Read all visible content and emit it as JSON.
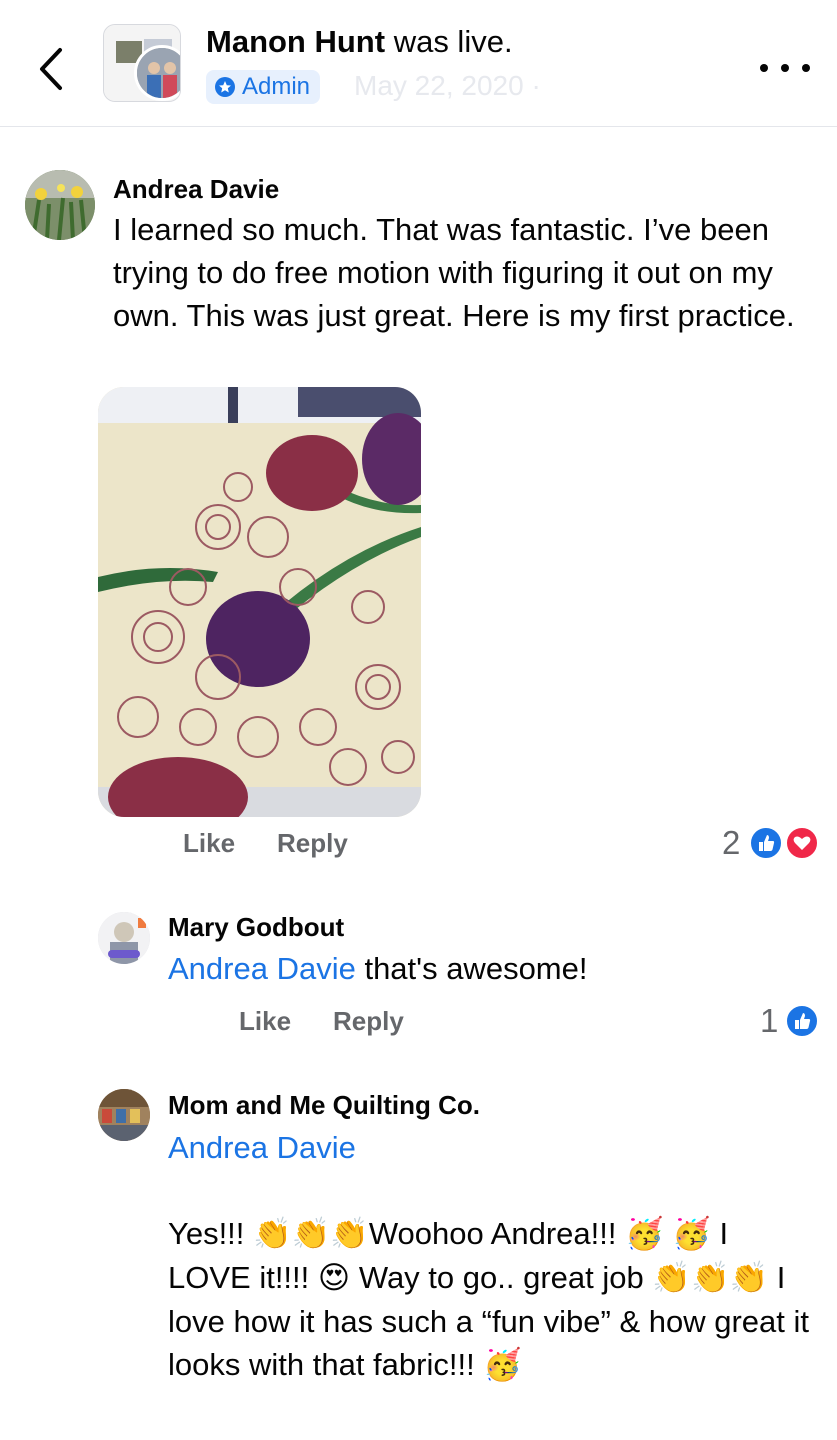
{
  "header": {
    "name": "Manon Hunt",
    "title_suffix": " was live.",
    "admin_label": "Admin",
    "date": "May 22, 2020 ·"
  },
  "comments": [
    {
      "author": "Andrea Davie",
      "text": "I learned so much. That was fantastic. I’ve been trying to do free motion with figuring it out on my own. This was just great. Here is my first practice.",
      "like_label": "Like",
      "reply_label": "Reply",
      "reaction_count": "2",
      "reactions": [
        "like-icon",
        "love-icon"
      ]
    },
    {
      "author": "Mary Godbout",
      "mention": "Andrea Davie",
      "text": " that's awesome!",
      "like_label": "Like",
      "reply_label": "Reply",
      "reaction_count": "1",
      "reactions": [
        "like-icon"
      ]
    },
    {
      "author": "Mom and Me Quilting Co.",
      "mention": "Andrea Davie",
      "text_parts": {
        "p1": "Yes!!! ",
        "p2": "Woohoo Andrea!!! ",
        "p3": " I LOVE it!!!! ",
        "p4": " Way to go.. great job ",
        "p5": " I love how it has such a “fun vibe” & how great it looks with that fabric!!! "
      },
      "emojis": {
        "clap": "👏",
        "party": "🥳",
        "heart_eyes": "😍"
      }
    }
  ],
  "colors": {
    "accent": "#1b74e4",
    "love": "#f02849",
    "secondary_text": "#65676b"
  }
}
